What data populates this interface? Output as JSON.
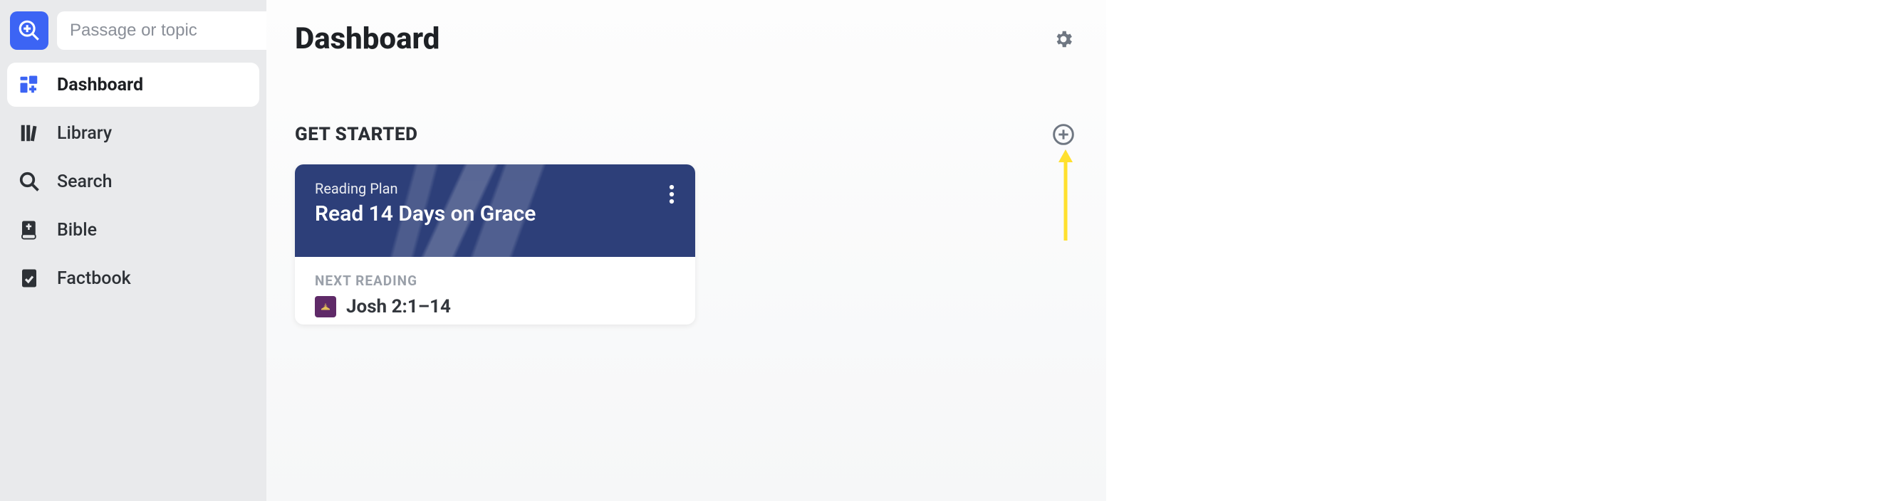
{
  "search": {
    "placeholder": "Passage or topic"
  },
  "nav": {
    "dashboard": "Dashboard",
    "library": "Library",
    "search": "Search",
    "bible": "Bible",
    "factbook": "Factbook"
  },
  "header": {
    "title": "Dashboard"
  },
  "section": {
    "title": "GET STARTED"
  },
  "card": {
    "subtitle": "Reading Plan",
    "title": "Read 14 Days on Grace",
    "next_label": "NEXT READING",
    "reading": "Josh 2:1–14"
  }
}
